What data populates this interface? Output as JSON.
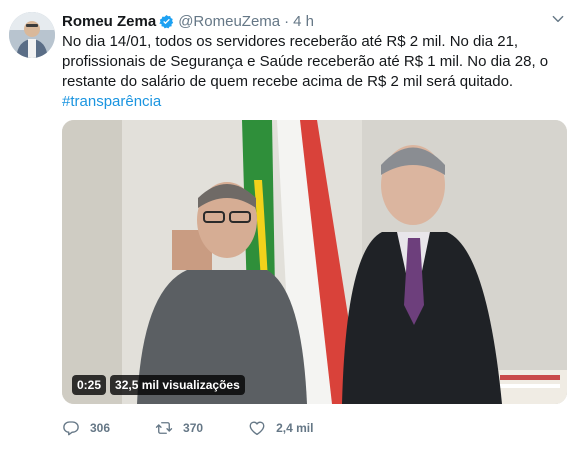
{
  "tweet": {
    "author_name": "Romeu Zema",
    "handle": "@RomeuZema",
    "separator": "·",
    "time": "4 h",
    "text": "No dia 14/01, todos os servidores receberão até R$ 2 mil. No dia 21, profissionais de Segurança e Saúde receberão até R$ 1 mil. No dia 28, o restante do salário de quem recebe acima de R$ 2 mil será quitado.",
    "hashtag": "#transparência",
    "icons": {
      "verified": "verified-badge-icon",
      "caret": "chevron-down-icon",
      "reply": "reply-icon",
      "retweet": "retweet-icon",
      "like": "heart-icon"
    },
    "colors": {
      "link": "#1b95e0",
      "verified": "#1da1f2",
      "muted": "#657786"
    }
  },
  "video": {
    "duration": "0:25",
    "views": "32,5 mil visualizações"
  },
  "actions": {
    "replies": "306",
    "retweets": "370",
    "likes": "2,4 mil"
  }
}
